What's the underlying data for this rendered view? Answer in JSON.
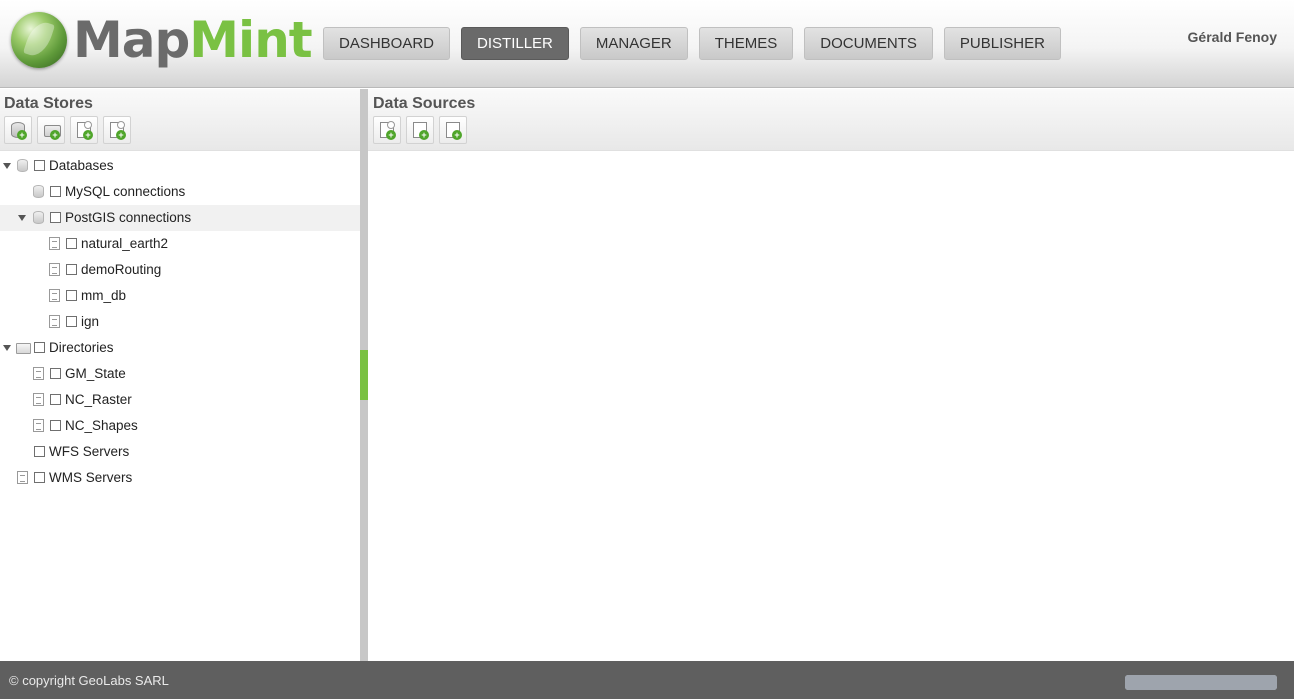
{
  "header": {
    "logo": {
      "part1": "Map",
      "part2": "Mint"
    },
    "nav": [
      {
        "label": "DASHBOARD",
        "active": false
      },
      {
        "label": "DISTILLER",
        "active": true
      },
      {
        "label": "MANAGER",
        "active": false
      },
      {
        "label": "THEMES",
        "active": false
      },
      {
        "label": "DOCUMENTS",
        "active": false
      },
      {
        "label": "PUBLISHER",
        "active": false
      }
    ],
    "user": "Gérald Fenoy"
  },
  "left_panel": {
    "title": "Data Stores",
    "tools": [
      "add-database-icon",
      "add-directory-icon",
      "add-wfs-server-icon",
      "add-wms-server-icon"
    ],
    "tree": [
      {
        "label": "Databases",
        "expanded": true
      },
      {
        "label": "MySQL connections"
      },
      {
        "label": "PostGIS connections",
        "expanded": true
      },
      {
        "label": "natural_earth2"
      },
      {
        "label": "demoRouting"
      },
      {
        "label": "mm_db"
      },
      {
        "label": "ign"
      },
      {
        "label": "Directories",
        "expanded": true
      },
      {
        "label": "GM_State"
      },
      {
        "label": "NC_Raster"
      },
      {
        "label": "NC_Shapes"
      },
      {
        "label": "WFS Servers"
      },
      {
        "label": "WMS Servers"
      }
    ]
  },
  "right_panel": {
    "title": "Data Sources",
    "tools": [
      "add-source-icon",
      "add-vector-source-icon",
      "add-raster-source-icon"
    ]
  },
  "footer": {
    "copyright": "© copyright GeoLabs SARL",
    "progress": 1.0
  },
  "colors": {
    "accent_green": "#7ac143",
    "active_nav": "#6a6a6a",
    "footer_bg": "#5f5f5f"
  }
}
